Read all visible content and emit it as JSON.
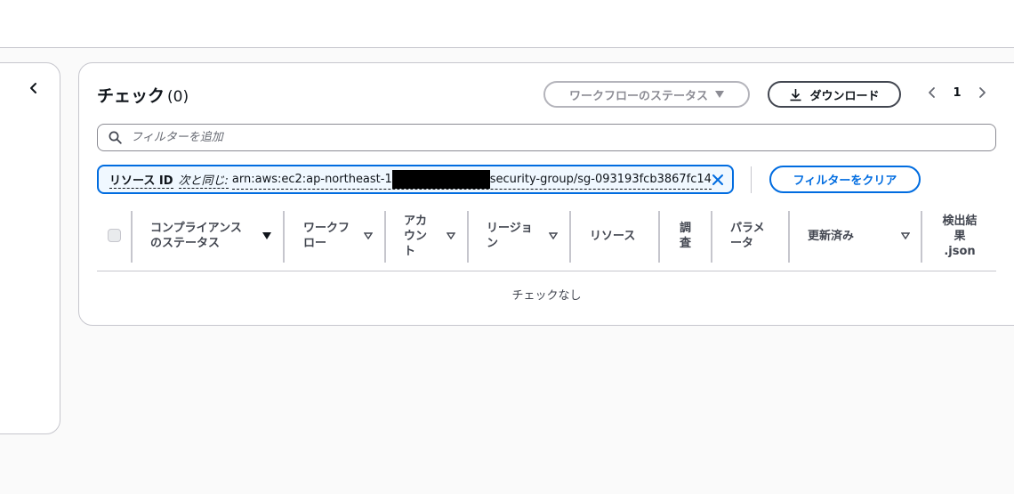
{
  "card": {
    "title": "チェック",
    "count": "(0)",
    "workflow_status_label": "ワークフローのステータス",
    "download_label": "ダウンロード",
    "page_number": "1"
  },
  "search": {
    "placeholder": "フィルターを追加"
  },
  "filter_token": {
    "key": "リソース ID",
    "operator": "次と同じ:",
    "value_prefix": "arn:aws:ec2:ap-northeast-1",
    "value_suffix": "security-group/sg-093193fcb3867fc14"
  },
  "clear_filters_label": "フィルターをクリア",
  "table": {
    "columns": [
      {
        "label": "コンプライアンス\nのステータス",
        "sorted": true
      },
      {
        "label": "ワークフ\nロー",
        "sorted": false
      },
      {
        "label": "アカ\nウン\nト",
        "sorted": false
      },
      {
        "label": "リージョ\nン",
        "sorted": false
      },
      {
        "label": "リソース",
        "sorted": false
      },
      {
        "label": "調\n査",
        "sorted": false
      },
      {
        "label": "パラメ\nータ",
        "sorted": false
      },
      {
        "label": "更新済み",
        "sorted": false
      },
      {
        "label": "検出結\n果\n.json",
        "sorted": false
      }
    ],
    "empty_message": "チェックなし"
  },
  "colors": {
    "primary": "#006ce0",
    "border": "#c6c6cd",
    "text": "#0f141a"
  }
}
